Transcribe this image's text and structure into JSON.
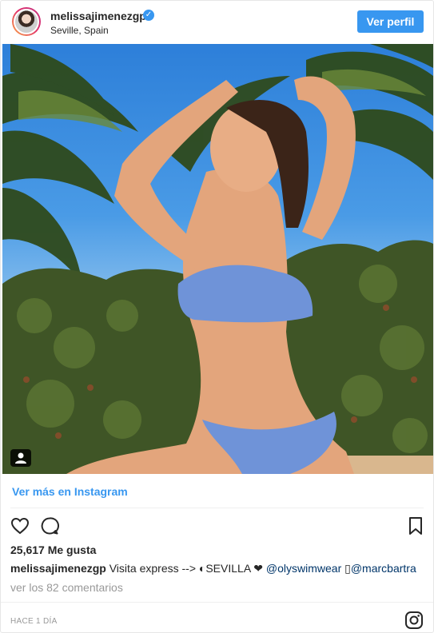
{
  "header": {
    "username": "melissajimenezgp",
    "verified_glyph": "✓",
    "location": "Seville, Spain",
    "profile_button": "Ver perfil",
    "accent_color": "#3897f0"
  },
  "post": {
    "view_more": "Ver más en Instagram",
    "likes": "25,617 Me gusta",
    "caption": {
      "username": "melissajimenezgp",
      "text": "Visita express --> ◐SEVILLA ",
      "heart": "❤",
      "mention_1": "@olyswimwear",
      "separator": " ▯",
      "mention_2": "@marcbartra"
    },
    "comments_link": "ver los 82 comentarios",
    "timestamp": "HACE 1 DÍA"
  },
  "icons": {
    "like": "heart-icon",
    "comment": "comment-icon",
    "save": "bookmark-icon",
    "logo": "instagram-icon",
    "tag": "user-tag-icon"
  }
}
